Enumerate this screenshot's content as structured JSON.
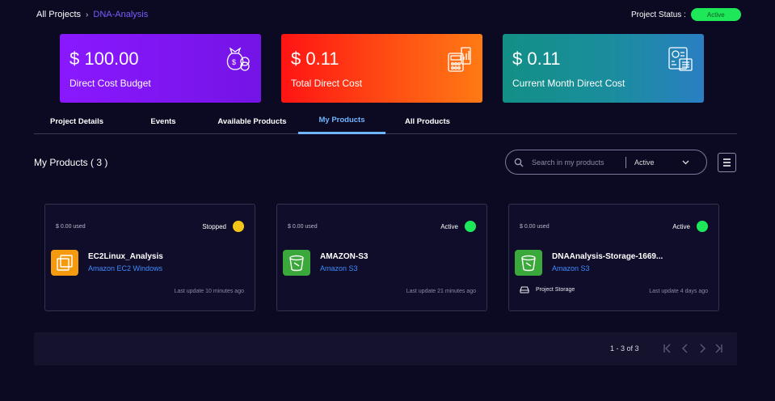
{
  "breadcrumb": {
    "root": "All Projects",
    "current": "DNA-Analysis"
  },
  "project_status": {
    "label": "Project Status :",
    "value": "Active"
  },
  "cost_cards": [
    {
      "amount": "$ 100.00",
      "label": "Direct Cost Budget",
      "icon": "money-bag-icon"
    },
    {
      "amount": "$ 0.11",
      "label": "Total Direct Cost",
      "icon": "calculator-icon"
    },
    {
      "amount": "$ 0.11",
      "label": "Current Month Direct Cost",
      "icon": "report-icon"
    }
  ],
  "tabs": [
    {
      "label": "Project Details",
      "active": false
    },
    {
      "label": "Events",
      "active": false
    },
    {
      "label": "Available Products",
      "active": false
    },
    {
      "label": "My Products",
      "active": true
    },
    {
      "label": "All Products",
      "active": false
    }
  ],
  "products_section": {
    "title": "My Products ( 3 )",
    "search_placeholder": "Search in my products",
    "filter_value": "Active"
  },
  "products": [
    {
      "used": "$ 0.00 used",
      "status": "Stopped",
      "status_color": "#f5c518",
      "name": "EC2Linux_Analysis",
      "type": "Amazon EC2 Windows",
      "icon": "ec2-icon",
      "icon_color": "#f59a0f",
      "updated": "Last update 10 minutes ago",
      "extra": ""
    },
    {
      "used": "$ 0.00 used",
      "status": "Active",
      "status_color": "#1ee85a",
      "name": "AMAZON-S3",
      "type": "Amazon S3",
      "icon": "s3-bucket-icon",
      "icon_color": "#3aa83a",
      "updated": "Last update 21 minutes ago",
      "extra": ""
    },
    {
      "used": "$ 0.00 used",
      "status": "Active",
      "status_color": "#1ee85a",
      "name": "DNAAnalysis-Storage-1669...",
      "type": "Amazon S3",
      "icon": "s3-bucket-icon",
      "icon_color": "#3aa83a",
      "updated": "Last update 4 days ago",
      "extra": "Project Storage"
    }
  ],
  "pagination": {
    "range": "1 - 3 of 3"
  }
}
